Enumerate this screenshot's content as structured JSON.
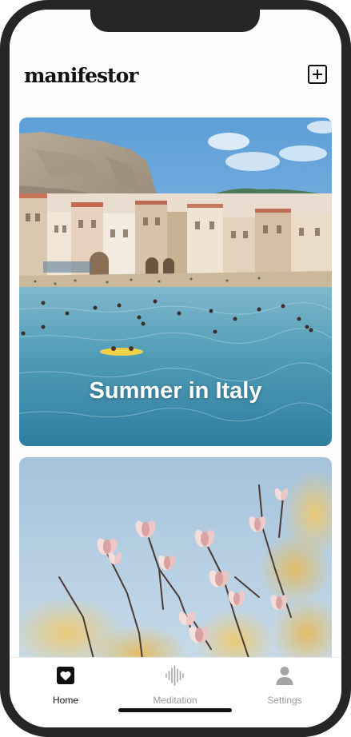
{
  "app": {
    "logo": "manifestor"
  },
  "header": {
    "add_icon": "plus-square-icon"
  },
  "cards": [
    {
      "title": "Summer in Italy",
      "image": "italian-seaside-town-photo"
    },
    {
      "title": "",
      "image": "magnolia-blossoms-photo"
    }
  ],
  "tabbar": {
    "tabs": [
      {
        "label": "Home",
        "icon": "heart-square-icon",
        "active": true
      },
      {
        "label": "Meditation",
        "icon": "sound-wave-icon",
        "active": false
      },
      {
        "label": "Settings",
        "icon": "person-icon",
        "active": false
      }
    ]
  },
  "colors": {
    "active": "#111111",
    "inactive": "#9a9a9a",
    "frame": "#262626"
  }
}
